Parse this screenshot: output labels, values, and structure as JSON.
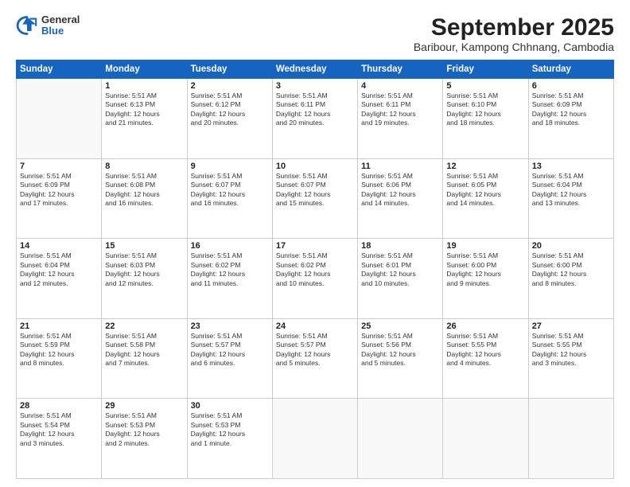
{
  "header": {
    "logo_general": "General",
    "logo_blue": "Blue",
    "month_title": "September 2025",
    "location": "Baribour, Kampong Chhnang, Cambodia"
  },
  "days_of_week": [
    "Sunday",
    "Monday",
    "Tuesday",
    "Wednesday",
    "Thursday",
    "Friday",
    "Saturday"
  ],
  "weeks": [
    [
      {
        "day": "",
        "info": ""
      },
      {
        "day": "1",
        "info": "Sunrise: 5:51 AM\nSunset: 6:13 PM\nDaylight: 12 hours\nand 21 minutes."
      },
      {
        "day": "2",
        "info": "Sunrise: 5:51 AM\nSunset: 6:12 PM\nDaylight: 12 hours\nand 20 minutes."
      },
      {
        "day": "3",
        "info": "Sunrise: 5:51 AM\nSunset: 6:11 PM\nDaylight: 12 hours\nand 20 minutes."
      },
      {
        "day": "4",
        "info": "Sunrise: 5:51 AM\nSunset: 6:11 PM\nDaylight: 12 hours\nand 19 minutes."
      },
      {
        "day": "5",
        "info": "Sunrise: 5:51 AM\nSunset: 6:10 PM\nDaylight: 12 hours\nand 18 minutes."
      },
      {
        "day": "6",
        "info": "Sunrise: 5:51 AM\nSunset: 6:09 PM\nDaylight: 12 hours\nand 18 minutes."
      }
    ],
    [
      {
        "day": "7",
        "info": "Sunrise: 5:51 AM\nSunset: 6:09 PM\nDaylight: 12 hours\nand 17 minutes."
      },
      {
        "day": "8",
        "info": "Sunrise: 5:51 AM\nSunset: 6:08 PM\nDaylight: 12 hours\nand 16 minutes."
      },
      {
        "day": "9",
        "info": "Sunrise: 5:51 AM\nSunset: 6:07 PM\nDaylight: 12 hours\nand 16 minutes."
      },
      {
        "day": "10",
        "info": "Sunrise: 5:51 AM\nSunset: 6:07 PM\nDaylight: 12 hours\nand 15 minutes."
      },
      {
        "day": "11",
        "info": "Sunrise: 5:51 AM\nSunset: 6:06 PM\nDaylight: 12 hours\nand 14 minutes."
      },
      {
        "day": "12",
        "info": "Sunrise: 5:51 AM\nSunset: 6:05 PM\nDaylight: 12 hours\nand 14 minutes."
      },
      {
        "day": "13",
        "info": "Sunrise: 5:51 AM\nSunset: 6:04 PM\nDaylight: 12 hours\nand 13 minutes."
      }
    ],
    [
      {
        "day": "14",
        "info": "Sunrise: 5:51 AM\nSunset: 6:04 PM\nDaylight: 12 hours\nand 12 minutes."
      },
      {
        "day": "15",
        "info": "Sunrise: 5:51 AM\nSunset: 6:03 PM\nDaylight: 12 hours\nand 12 minutes."
      },
      {
        "day": "16",
        "info": "Sunrise: 5:51 AM\nSunset: 6:02 PM\nDaylight: 12 hours\nand 11 minutes."
      },
      {
        "day": "17",
        "info": "Sunrise: 5:51 AM\nSunset: 6:02 PM\nDaylight: 12 hours\nand 10 minutes."
      },
      {
        "day": "18",
        "info": "Sunrise: 5:51 AM\nSunset: 6:01 PM\nDaylight: 12 hours\nand 10 minutes."
      },
      {
        "day": "19",
        "info": "Sunrise: 5:51 AM\nSunset: 6:00 PM\nDaylight: 12 hours\nand 9 minutes."
      },
      {
        "day": "20",
        "info": "Sunrise: 5:51 AM\nSunset: 6:00 PM\nDaylight: 12 hours\nand 8 minutes."
      }
    ],
    [
      {
        "day": "21",
        "info": "Sunrise: 5:51 AM\nSunset: 5:59 PM\nDaylight: 12 hours\nand 8 minutes."
      },
      {
        "day": "22",
        "info": "Sunrise: 5:51 AM\nSunset: 5:58 PM\nDaylight: 12 hours\nand 7 minutes."
      },
      {
        "day": "23",
        "info": "Sunrise: 5:51 AM\nSunset: 5:57 PM\nDaylight: 12 hours\nand 6 minutes."
      },
      {
        "day": "24",
        "info": "Sunrise: 5:51 AM\nSunset: 5:57 PM\nDaylight: 12 hours\nand 5 minutes."
      },
      {
        "day": "25",
        "info": "Sunrise: 5:51 AM\nSunset: 5:56 PM\nDaylight: 12 hours\nand 5 minutes."
      },
      {
        "day": "26",
        "info": "Sunrise: 5:51 AM\nSunset: 5:55 PM\nDaylight: 12 hours\nand 4 minutes."
      },
      {
        "day": "27",
        "info": "Sunrise: 5:51 AM\nSunset: 5:55 PM\nDaylight: 12 hours\nand 3 minutes."
      }
    ],
    [
      {
        "day": "28",
        "info": "Sunrise: 5:51 AM\nSunset: 5:54 PM\nDaylight: 12 hours\nand 3 minutes."
      },
      {
        "day": "29",
        "info": "Sunrise: 5:51 AM\nSunset: 5:53 PM\nDaylight: 12 hours\nand 2 minutes."
      },
      {
        "day": "30",
        "info": "Sunrise: 5:51 AM\nSunset: 5:53 PM\nDaylight: 12 hours\nand 1 minute."
      },
      {
        "day": "",
        "info": ""
      },
      {
        "day": "",
        "info": ""
      },
      {
        "day": "",
        "info": ""
      },
      {
        "day": "",
        "info": ""
      }
    ]
  ]
}
